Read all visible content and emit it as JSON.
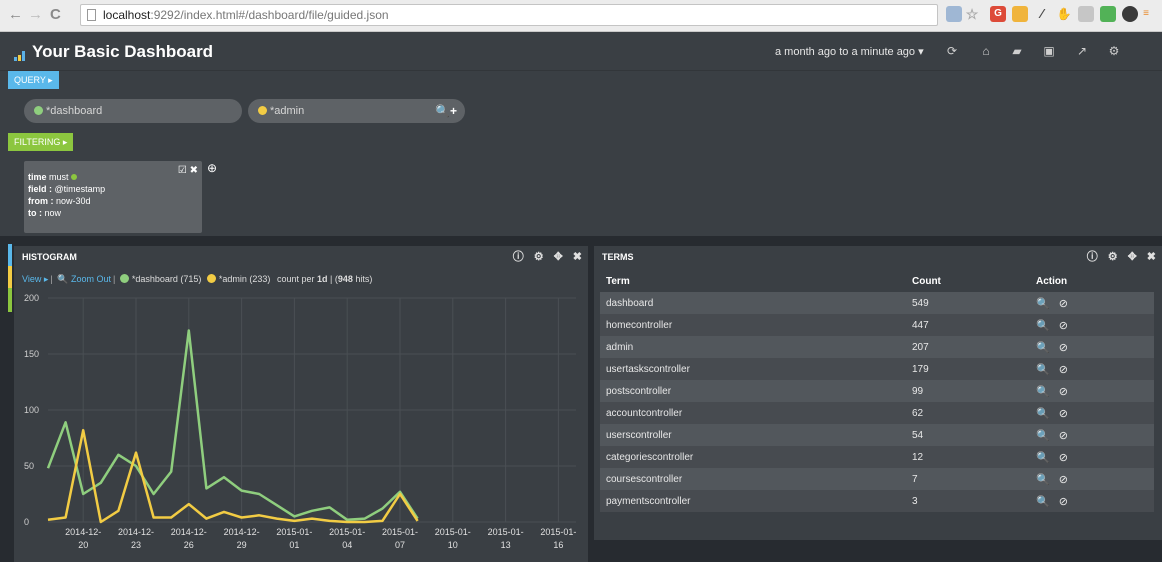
{
  "browser": {
    "url_host": "localhost",
    "url_rest": ":9292/index.html#/dashboard/file/guided.json",
    "back": "←",
    "forward": "→",
    "reload": "C"
  },
  "header": {
    "title": "Your Basic Dashboard",
    "timerange": "a month ago to a minute ago ▾",
    "icons": [
      "refresh-icon",
      "home-icon",
      "folder-open-icon",
      "save-icon",
      "share-icon",
      "gear-icon"
    ]
  },
  "query": {
    "tag_label": "QUERY ▸",
    "pills": [
      {
        "text": "*dashboard",
        "color": "#8fce7e"
      },
      {
        "text": "*admin",
        "color": "#f2cc44"
      }
    ],
    "actions": "🔍+"
  },
  "filtering": {
    "tag_label": "FILTERING ▸",
    "card": {
      "line1_key": "time",
      "line1_val": " must ",
      "line2_key": "field :",
      "line2_val": " @timestamp",
      "line3_key": "from :",
      "line3_val": " now-30d",
      "line4_key": "to :",
      "line4_val": " now"
    },
    "tools": "☑ ✖",
    "add": "⊕"
  },
  "histogram": {
    "title": "HISTOGRAM",
    "tools": [
      "ⓘ",
      "⚙",
      "✥",
      "✖"
    ],
    "view_label": "View ▸",
    "zoom_label": "🔍 Zoom Out",
    "legend1": "*dashboard (715)",
    "legend2": "*admin (233)",
    "count_per": "count per ",
    "interval": "1d",
    "hits_sep": " | (",
    "hits": "948",
    "hits_suffix": " hits)"
  },
  "terms": {
    "title": "TERMS",
    "tools": [
      "ⓘ",
      "⚙",
      "✥",
      "✖"
    ],
    "columns": [
      "Term",
      "Count",
      "Action"
    ],
    "action_glyph": "🔍 ⊘",
    "rows": [
      {
        "term": "dashboard",
        "count": "549"
      },
      {
        "term": "homecontroller",
        "count": "447"
      },
      {
        "term": "admin",
        "count": "207"
      },
      {
        "term": "usertaskscontroller",
        "count": "179"
      },
      {
        "term": "postscontroller",
        "count": "99"
      },
      {
        "term": "accountcontroller",
        "count": "62"
      },
      {
        "term": "userscontroller",
        "count": "54"
      },
      {
        "term": "categoriescontroller",
        "count": "12"
      },
      {
        "term": "coursescontroller",
        "count": "7"
      },
      {
        "term": "paymentscontroller",
        "count": "3"
      }
    ]
  },
  "colors": {
    "dashboard": "#8fce7e",
    "admin": "#f2cc44",
    "query_tag": "#5ab8ea",
    "filter_tag": "#8cc63f"
  },
  "chart_data": {
    "type": "line",
    "ylim": [
      0,
      200
    ],
    "yticks": [
      0,
      50,
      100,
      150,
      200
    ],
    "xticks": [
      [
        "2014-12-",
        "20"
      ],
      [
        "2014-12-",
        "23"
      ],
      [
        "2014-12-",
        "26"
      ],
      [
        "2014-12-",
        "29"
      ],
      [
        "2015-01-",
        "01"
      ],
      [
        "2015-01-",
        "04"
      ],
      [
        "2015-01-",
        "07"
      ],
      [
        "2015-01-",
        "10"
      ],
      [
        "2015-01-",
        "13"
      ],
      [
        "2015-01-",
        "16"
      ]
    ],
    "x_start": "2014-12-18",
    "x_end": "2015-01-17",
    "series": [
      {
        "name": "*dashboard",
        "color": "#8fce7e",
        "points": [
          [
            "2014-12-18",
            48
          ],
          [
            "2014-12-19",
            89
          ],
          [
            "2014-12-20",
            25
          ],
          [
            "2014-12-21",
            35
          ],
          [
            "2014-12-22",
            60
          ],
          [
            "2014-12-23",
            50
          ],
          [
            "2014-12-24",
            25
          ],
          [
            "2014-12-25",
            45
          ],
          [
            "2014-12-26",
            171
          ],
          [
            "2014-12-27",
            30
          ],
          [
            "2014-12-28",
            40
          ],
          [
            "2014-12-29",
            28
          ],
          [
            "2014-12-30",
            25
          ],
          [
            "2014-12-31",
            15
          ],
          [
            "2015-01-01",
            5
          ],
          [
            "2015-01-02",
            10
          ],
          [
            "2015-01-03",
            13
          ],
          [
            "2015-01-04",
            2
          ],
          [
            "2015-01-05",
            3
          ],
          [
            "2015-01-06",
            12
          ],
          [
            "2015-01-07",
            27
          ],
          [
            "2015-01-08",
            3
          ]
        ]
      },
      {
        "name": "*admin",
        "color": "#f2cc44",
        "points": [
          [
            "2014-12-18",
            2
          ],
          [
            "2014-12-19",
            4
          ],
          [
            "2014-12-20",
            82
          ],
          [
            "2014-12-21",
            0
          ],
          [
            "2014-12-22",
            10
          ],
          [
            "2014-12-23",
            62
          ],
          [
            "2014-12-24",
            4
          ],
          [
            "2014-12-25",
            4
          ],
          [
            "2014-12-26",
            16
          ],
          [
            "2014-12-27",
            3
          ],
          [
            "2014-12-28",
            9
          ],
          [
            "2014-12-29",
            4
          ],
          [
            "2014-12-30",
            6
          ],
          [
            "2014-12-31",
            3
          ],
          [
            "2015-01-01",
            1
          ],
          [
            "2015-01-02",
            3
          ],
          [
            "2015-01-03",
            1
          ],
          [
            "2015-01-04",
            0
          ],
          [
            "2015-01-05",
            0
          ],
          [
            "2015-01-06",
            1
          ],
          [
            "2015-01-07",
            25
          ],
          [
            "2015-01-08",
            1
          ]
        ]
      }
    ]
  }
}
